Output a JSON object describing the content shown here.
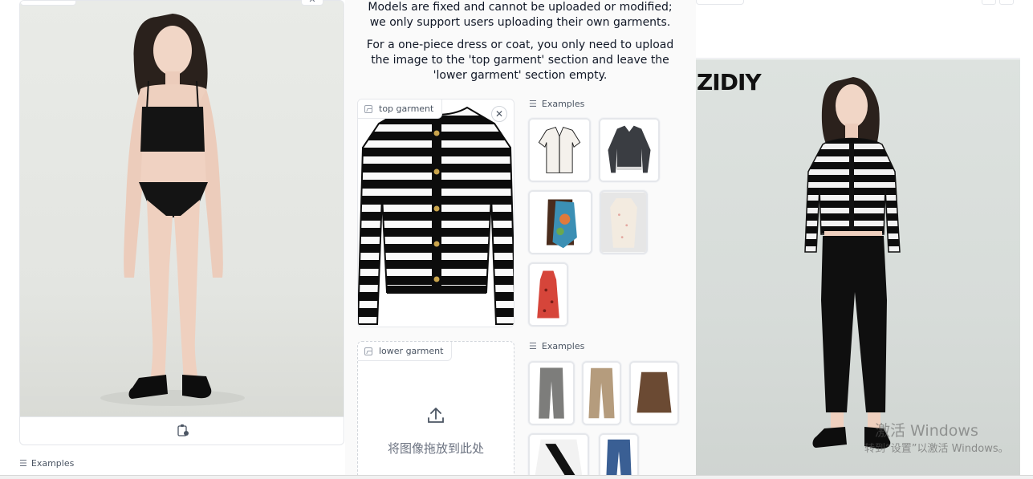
{
  "notes": {
    "line1": "Models are fixed and cannot be uploaded or modified; we only support users uploading their own garments.",
    "line2": "For a one-piece dress or coat, you only need to upload the image to the 'top garment' section and leave the 'lower garment' section empty."
  },
  "top_garment": {
    "label": "top garment",
    "clear_symbol": "✕"
  },
  "lower_garment": {
    "label": "lower garment",
    "upload_text": "将图像拖放到此处"
  },
  "examples_top": {
    "label": "Examples"
  },
  "examples_lower": {
    "label": "Examples"
  },
  "examples_left": {
    "label": "Examples"
  },
  "result": {
    "brand_text": "ZIDIY"
  },
  "watermark": {
    "line1": "激活 Windows",
    "line2": "转到“设置”以激活 Windows。"
  },
  "colors": {
    "border": "#e5e7eb",
    "text": "#111827",
    "muted": "#6b7280"
  },
  "icons": {
    "left_close": "close-icon",
    "left_tool": "share-icon",
    "upload": "upload-icon",
    "image": "image-icon",
    "list": "list-icon"
  }
}
